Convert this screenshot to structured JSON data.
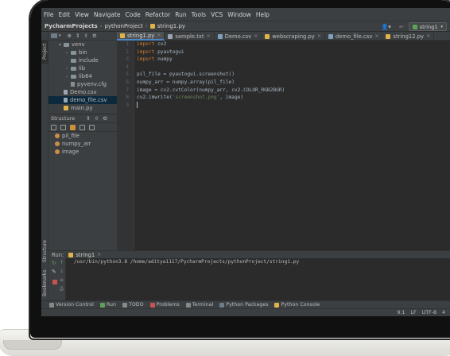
{
  "menu": [
    "File",
    "Edit",
    "View",
    "Navigate",
    "Code",
    "Refactor",
    "Run",
    "Tools",
    "VCS",
    "Window",
    "Help"
  ],
  "breadcrumb": {
    "project": "PycharmProjects",
    "sub": "pythonProject",
    "file": "string1.py"
  },
  "run_config": "string1",
  "left_tool_tabs": {
    "project": "Project",
    "structure": "Structure",
    "bookmarks": "Bookmarks"
  },
  "project_tree": [
    {
      "name": "venv",
      "indent": 1,
      "arrow": "▾",
      "kind": "folder"
    },
    {
      "name": "bin",
      "indent": 2,
      "arrow": "›",
      "kind": "folder"
    },
    {
      "name": "include",
      "indent": 2,
      "arrow": "",
      "kind": "folder"
    },
    {
      "name": "lib",
      "indent": 2,
      "arrow": "›",
      "kind": "folder"
    },
    {
      "name": "lib64",
      "indent": 2,
      "arrow": "›",
      "kind": "folder"
    },
    {
      "name": "pyvenv.cfg",
      "indent": 2,
      "arrow": "",
      "kind": "cfg"
    },
    {
      "name": "Demo.csv",
      "indent": 1,
      "arrow": "",
      "kind": "csv"
    },
    {
      "name": "demo_file.csv",
      "indent": 1,
      "arrow": "",
      "kind": "csv",
      "selected": true
    },
    {
      "name": "main.py",
      "indent": 1,
      "arrow": "",
      "kind": "py"
    }
  ],
  "structure": {
    "title": "Structure",
    "items": [
      "pil_file",
      "numpy_arr",
      "image"
    ]
  },
  "tabs": [
    {
      "label": "string1.py",
      "kind": "py",
      "active": true
    },
    {
      "label": "sample.txt",
      "kind": "txt"
    },
    {
      "label": "Demo.csv",
      "kind": "csv"
    },
    {
      "label": "webscraping.py",
      "kind": "py"
    },
    {
      "label": "demo_file.csv",
      "kind": "csv"
    },
    {
      "label": "string12.py",
      "kind": "py"
    }
  ],
  "code": [
    [
      {
        "t": "import",
        "c": "kw"
      },
      {
        "t": " cv2"
      }
    ],
    [
      {
        "t": "import",
        "c": "kw"
      },
      {
        "t": " pyautogui"
      }
    ],
    [
      {
        "t": "import",
        "c": "kw"
      },
      {
        "t": " numpy"
      }
    ],
    [],
    [
      {
        "t": "pil_file = pyautogui.screenshot()"
      }
    ],
    [
      {
        "t": "numpy_arr = numpy.array(pil_file)"
      }
    ],
    [
      {
        "t": "image = cv2.cvtColor(numpy_arr, cv2.COLOR_RGB2BGR)"
      }
    ],
    [
      {
        "t": "cv2.imwrite("
      },
      {
        "t": "'screenshot.png'",
        "c": "str"
      },
      {
        "t": ", image)"
      }
    ],
    [
      {
        "caret": true
      }
    ]
  ],
  "run": {
    "label": "Run:",
    "config": "string1",
    "output": "/usr/bin/python3.8 /home/aditya1117/PycharmProjects/pythonProject/string1.py"
  },
  "bottom_tabs": [
    "Version Control",
    "Run",
    "TODO",
    "Problems",
    "Terminal",
    "Python Packages",
    "Python Console"
  ],
  "status": {
    "position": "9:1",
    "line_sep": "LF",
    "encoding": "UTF-8",
    "indent": "4"
  },
  "colors": {
    "accent": "#4a88c7",
    "keyword": "#cc7832",
    "string": "#6a8759"
  }
}
